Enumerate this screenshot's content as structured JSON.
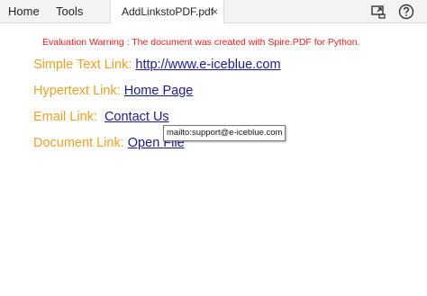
{
  "toolbar": {
    "menu": [
      "Home",
      "Tools"
    ],
    "tab_title": "AddLinkstoPDF.pdf",
    "tab_close": "×",
    "icons": [
      "share-icon",
      "help-icon"
    ]
  },
  "document": {
    "warning": "Evaluation Warning : The document was created with Spire.PDF for Python.",
    "links": [
      {
        "label": "Simple Text Link: ",
        "text": "http://www.e-iceblue.com"
      },
      {
        "label": "Hypertext Link: ",
        "text": "Home Page"
      },
      {
        "label": "Email Link: ",
        "text": "Contact Us"
      },
      {
        "label": "Document Link: ",
        "text": "Open File"
      }
    ],
    "tooltip": "mailto:support@e-iceblue.com"
  },
  "colors": {
    "warning": "#ff1a1a",
    "label": "#f0a020",
    "link": "#1a1aa0"
  }
}
